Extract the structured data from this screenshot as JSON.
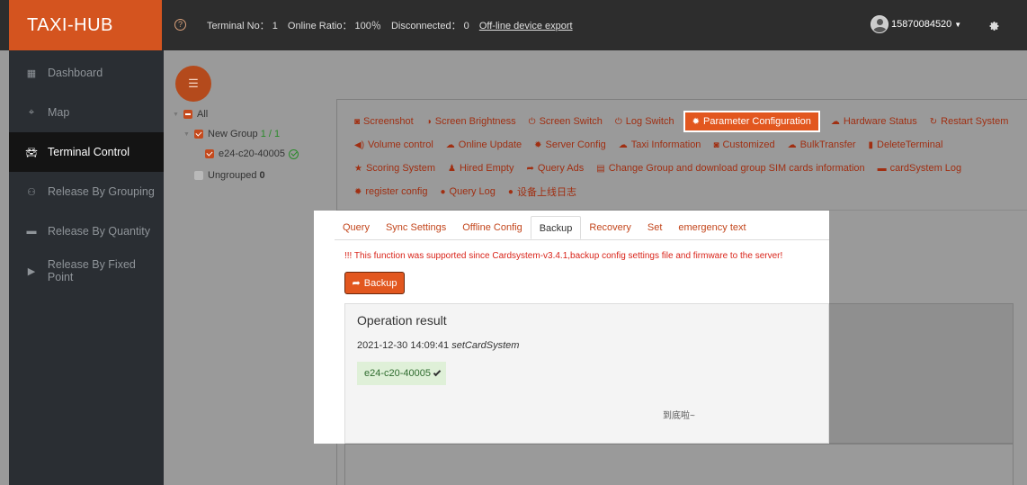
{
  "brand": "TAXI-HUB",
  "topbar": {
    "terminal_no": "Terminal No： 1",
    "online_ratio": "Online Ratio： 100％",
    "disconnected": "Disconnected： 0",
    "export_link": "Off-line device export",
    "username": "15870084520"
  },
  "sidebar": {
    "items": [
      {
        "label": "Dashboard",
        "icon": "dashboard-icon"
      },
      {
        "label": "Map",
        "icon": "map-icon"
      },
      {
        "label": "Terminal Control",
        "icon": "car-icon",
        "active": true
      },
      {
        "label": "Release By Grouping",
        "icon": "group-icon"
      },
      {
        "label": "Release By Quantity",
        "icon": "card-icon"
      },
      {
        "label": "Release By Fixed Point",
        "icon": "play-icon"
      }
    ]
  },
  "tree": {
    "all": "All",
    "group_name": "New Group",
    "group_count": "1 / 1",
    "device": "e24-c20-40005",
    "ungrouped": "Ungrouped",
    "ungrouped_count": "0"
  },
  "actions": {
    "row1": [
      "Screenshot",
      "Screen Brightness",
      "Screen Switch",
      "Log Switch",
      "Parameter Configuration",
      "Hardware Status",
      "Restart System"
    ],
    "row2": [
      "Volume control",
      "Online Update",
      "Server Config",
      "Taxi Information",
      "Customized",
      "BulkTransfer",
      "DeleteTerminal"
    ],
    "row3": [
      "Scoring System",
      "Hired Empty",
      "Query Ads",
      "Change Group and download group SIM cards information",
      "cardSystem Log"
    ],
    "row4": [
      "register config",
      "Query Log",
      "设备上线日志"
    ],
    "active": "Parameter Configuration"
  },
  "tabs": [
    "Query",
    "Sync Settings",
    "Offline Config",
    "Backup",
    "Recovery",
    "Set",
    "emergency text"
  ],
  "active_tab": "Backup",
  "warning": "!!! This function was supported since Cardsystem-v3.4.1,backup config settings file and firmware to the server!",
  "backup_button": "Backup",
  "result": {
    "title": "Operation result",
    "timestamp": "2021-12-30 14:09:41",
    "command": "setCardSystem",
    "device": "e24-c20-40005",
    "end_text": "到底啦~"
  },
  "colors": {
    "accent": "#e2571f",
    "brand": "#d4541f",
    "sidebar": "#2a2e33"
  }
}
